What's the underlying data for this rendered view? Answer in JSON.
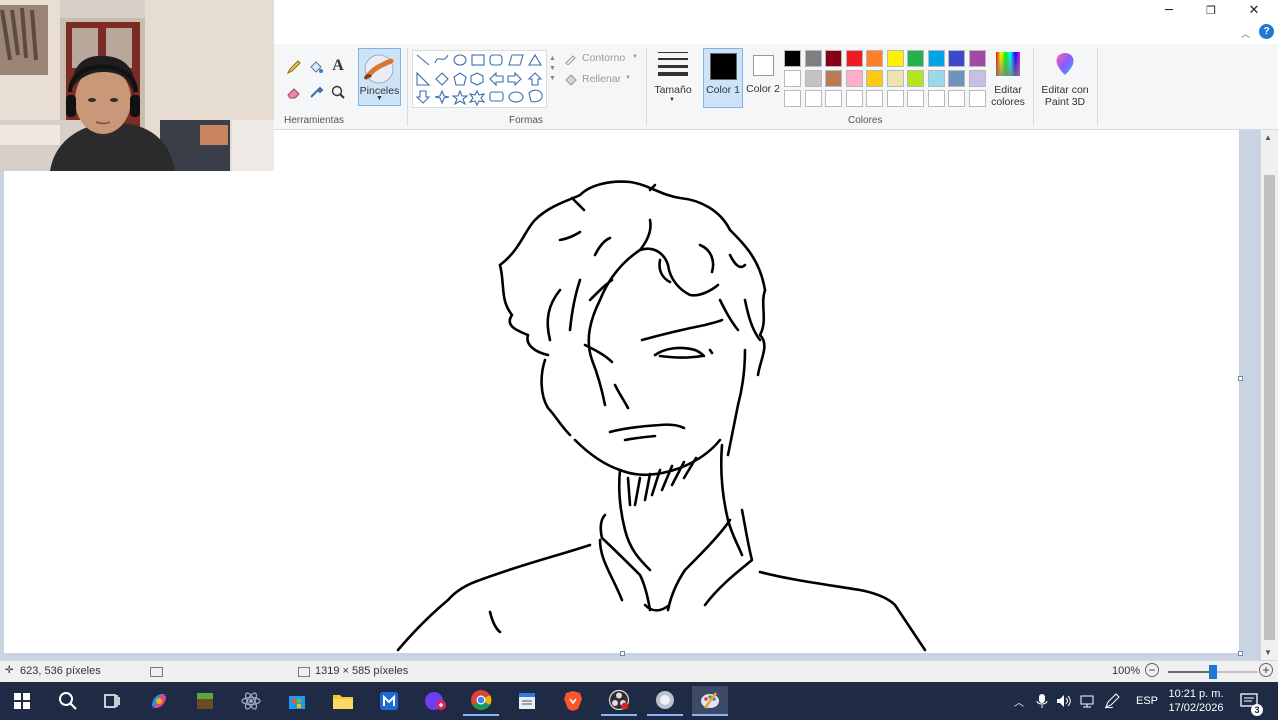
{
  "titlebar": {
    "minimize": "─",
    "restore": "❐",
    "close": "✕"
  },
  "ribbon": {
    "groups": {
      "tools": "Herramientas",
      "shapes": "Formas",
      "colors": "Colores"
    },
    "brushes_label": "Pinceles",
    "outline_label": "Contorno",
    "fill_label": "Rellenar",
    "size_label": "Tamaño",
    "color1_label": "Color 1",
    "color2_label": "Color 2",
    "edit_colors_label": "Editar colores",
    "edit_paint3d_label": "Editar con Paint 3D",
    "palette_row1": [
      "#000000",
      "#7f7f7f",
      "#880015",
      "#ed1c24",
      "#ff7f27",
      "#fff200",
      "#22b14c",
      "#00a2e8",
      "#3f48cc",
      "#a349a4"
    ],
    "palette_row2": [
      "#ffffff",
      "#c3c3c3",
      "#b97a57",
      "#ffaec9",
      "#ffc90e",
      "#efe4b0",
      "#b5e61d",
      "#99d9ea",
      "#7092be",
      "#c8bfe7"
    ],
    "color1": "#000000",
    "color2": "#ffffff"
  },
  "statusbar": {
    "cursor_pos": "623, 536 píxeles",
    "image_size": "1319 × 585 píxeles",
    "zoom": "100%"
  },
  "taskbar": {
    "lang": "ESP",
    "time": "10:21 p. m.",
    "date": "17/02/2026",
    "notifications": "3"
  }
}
